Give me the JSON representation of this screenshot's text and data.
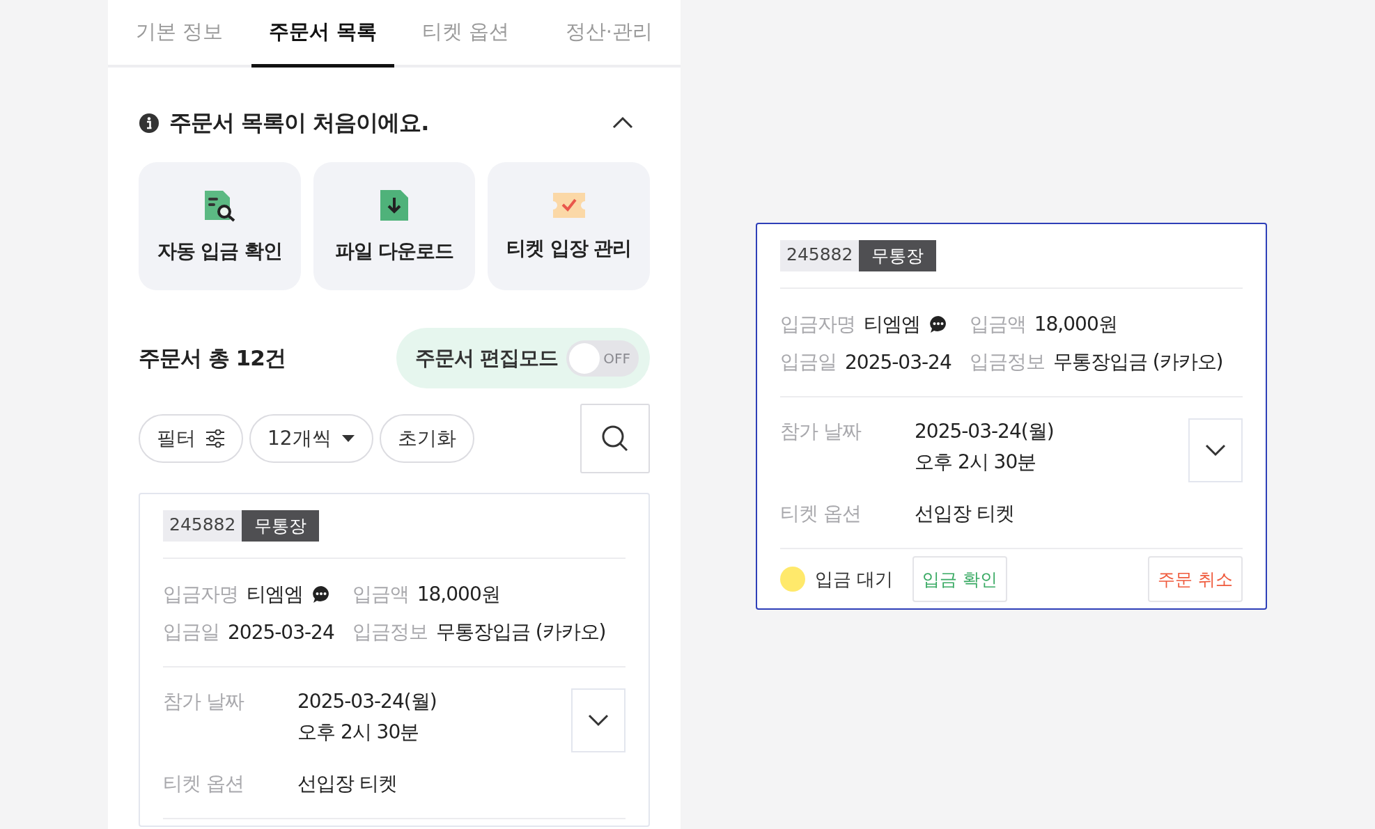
{
  "tabs": [
    {
      "label": "기본 정보",
      "selected": false
    },
    {
      "label": "주문서 목록",
      "selected": true
    },
    {
      "label": "티켓 옵션",
      "selected": false
    },
    {
      "label": "정산·관리",
      "selected": false
    }
  ],
  "notice": {
    "text": "주문서 목록이 처음이에요.",
    "expanded": true
  },
  "quick_actions": [
    {
      "kind": "search-doc",
      "label": "자동 입금 확인"
    },
    {
      "kind": "download",
      "label": "파일 다운로드"
    },
    {
      "kind": "ticket",
      "label": "티켓 입장 관리"
    }
  ],
  "order_count": "주문서 총 12건",
  "edit_mode": {
    "label": "주문서 편집모드",
    "on": false,
    "switch_text": "OFF"
  },
  "filters": [
    {
      "kind": "filter",
      "label": "필터"
    },
    {
      "kind": "page-size",
      "label": "12개씩"
    },
    {
      "kind": "reset",
      "label": "초기화"
    }
  ],
  "orders": [
    {
      "selected": false,
      "number": "245882",
      "method": "무통장",
      "fields": [
        {
          "label": "입금자명",
          "value": "티엠엠",
          "memo": true
        },
        {
          "label": "입금액",
          "value": "18,000원"
        },
        {
          "label": "입금일",
          "value": "2025-03-24"
        },
        {
          "label": "입금정보",
          "value": "무통장입금 (카카오)"
        }
      ],
      "date_label": "참가 날짜",
      "date_lines": [
        "2025-03-24(월)",
        "오후 2시 30분"
      ],
      "option_label": "티켓 옵션",
      "option_value": "선입장 티켓",
      "expanded": false
    },
    {
      "selected": true,
      "number": "245882",
      "method": "무통장",
      "fields": [
        {
          "label": "입금자명",
          "value": "티엠엠",
          "memo": true
        },
        {
          "label": "입금액",
          "value": "18,000원"
        },
        {
          "label": "입금일",
          "value": "2025-03-24"
        },
        {
          "label": "입금정보",
          "value": "무통장입금 (카카오)"
        }
      ],
      "date_label": "참가 날짜",
      "date_lines": [
        "2025-03-24(월)",
        "오후 2시 30분"
      ],
      "option_label": "티켓 옵션",
      "option_value": "선입장 티켓",
      "expanded": false,
      "footer": {
        "status": "입금 대기",
        "color": "#ffe96b",
        "confirm": "입금 확인",
        "cancel": "주문 취소"
      }
    }
  ]
}
